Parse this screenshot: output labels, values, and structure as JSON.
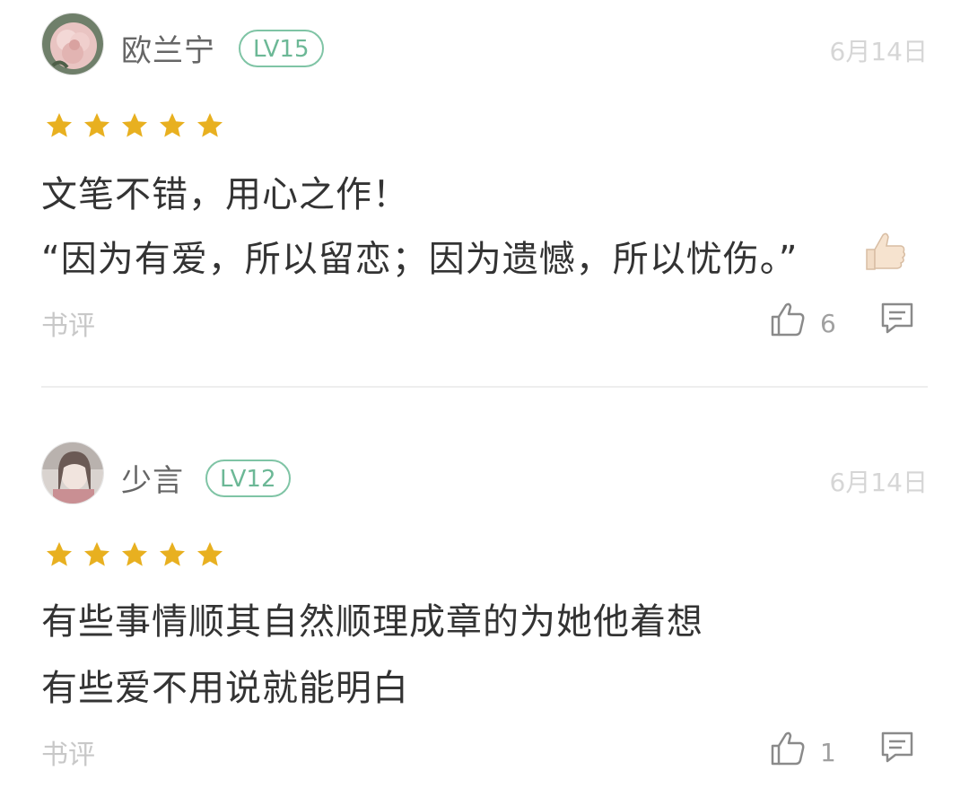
{
  "colors": {
    "star": "#e8b020",
    "level_badge": "#7fc4a5",
    "date_text": "#d6d6d6",
    "icon_gray": "#8a8a8a"
  },
  "reviews": [
    {
      "username": "欧兰宁",
      "level": "LV15",
      "date": "6月14日",
      "rating": 5,
      "lines": [
        "文笔不错，用心之作！",
        "“因为有爱，所以留恋；因为遗憾，所以忧伤。”"
      ],
      "trailing_emoji": "thumbs-up-emoji",
      "category": "书评",
      "likes": "6"
    },
    {
      "username": "少言",
      "level": "LV12",
      "date": "6月14日",
      "rating": 5,
      "lines": [
        "有些事情顺其自然顺理成章的为她他着想",
        "有些爱不用说就能明白"
      ],
      "category": "书评",
      "likes": "1"
    }
  ]
}
